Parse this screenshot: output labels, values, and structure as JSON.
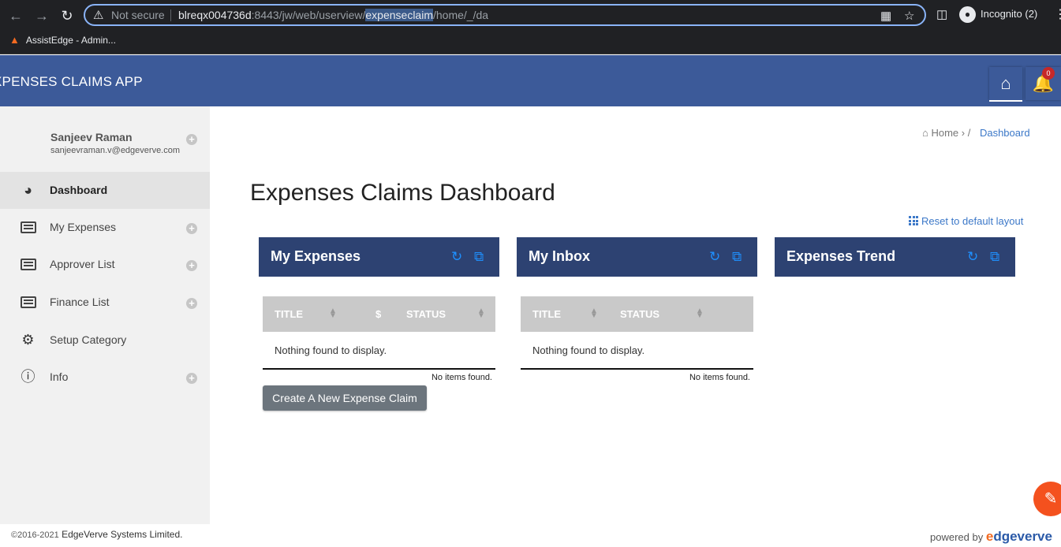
{
  "browser": {
    "security_label": "Not secure",
    "url_host": "blreqx004736d",
    "url_port_path": ":8443/jw/web/userview/",
    "url_selected": "expenseclaim",
    "url_rest": "/home/_/da",
    "incognito_label": "Incognito (2)",
    "bookmark_label": "AssistEdge - Admin..."
  },
  "header": {
    "app_title": "XPENSES CLAIMS APP",
    "notification_count": "0"
  },
  "user": {
    "name": "Sanjeev Raman",
    "email": "sanjeevraman.v@edgeverve.com"
  },
  "sidebar": {
    "items": [
      {
        "label": "Dashboard"
      },
      {
        "label": "My Expenses"
      },
      {
        "label": "Approver List"
      },
      {
        "label": "Finance List"
      },
      {
        "label": "Setup Category"
      },
      {
        "label": "Info"
      }
    ]
  },
  "breadcrumb": {
    "home": "Home",
    "current": "Dashboard"
  },
  "page": {
    "title": "Expenses Claims Dashboard",
    "reset_label": "Reset to default layout"
  },
  "widgets": {
    "expenses": {
      "title": "My Expenses",
      "col_title": "TITLE",
      "col_amount": "$",
      "col_status": "STATUS",
      "empty": "Nothing found to display.",
      "no_items": "No items found.",
      "create_label": "Create A New Expense Claim"
    },
    "inbox": {
      "title": "My Inbox",
      "col_title": "TITLE",
      "col_status": "STATUS",
      "empty": "Nothing found to display.",
      "no_items": "No items found."
    },
    "trend": {
      "title": "Expenses Trend"
    }
  },
  "footer": {
    "copyright_years": "©2016-2021",
    "company": "EdgeVerve Systems Limited.",
    "powered_by": "powered by",
    "brand_e": "e",
    "brand_rest": "dgeverve"
  }
}
